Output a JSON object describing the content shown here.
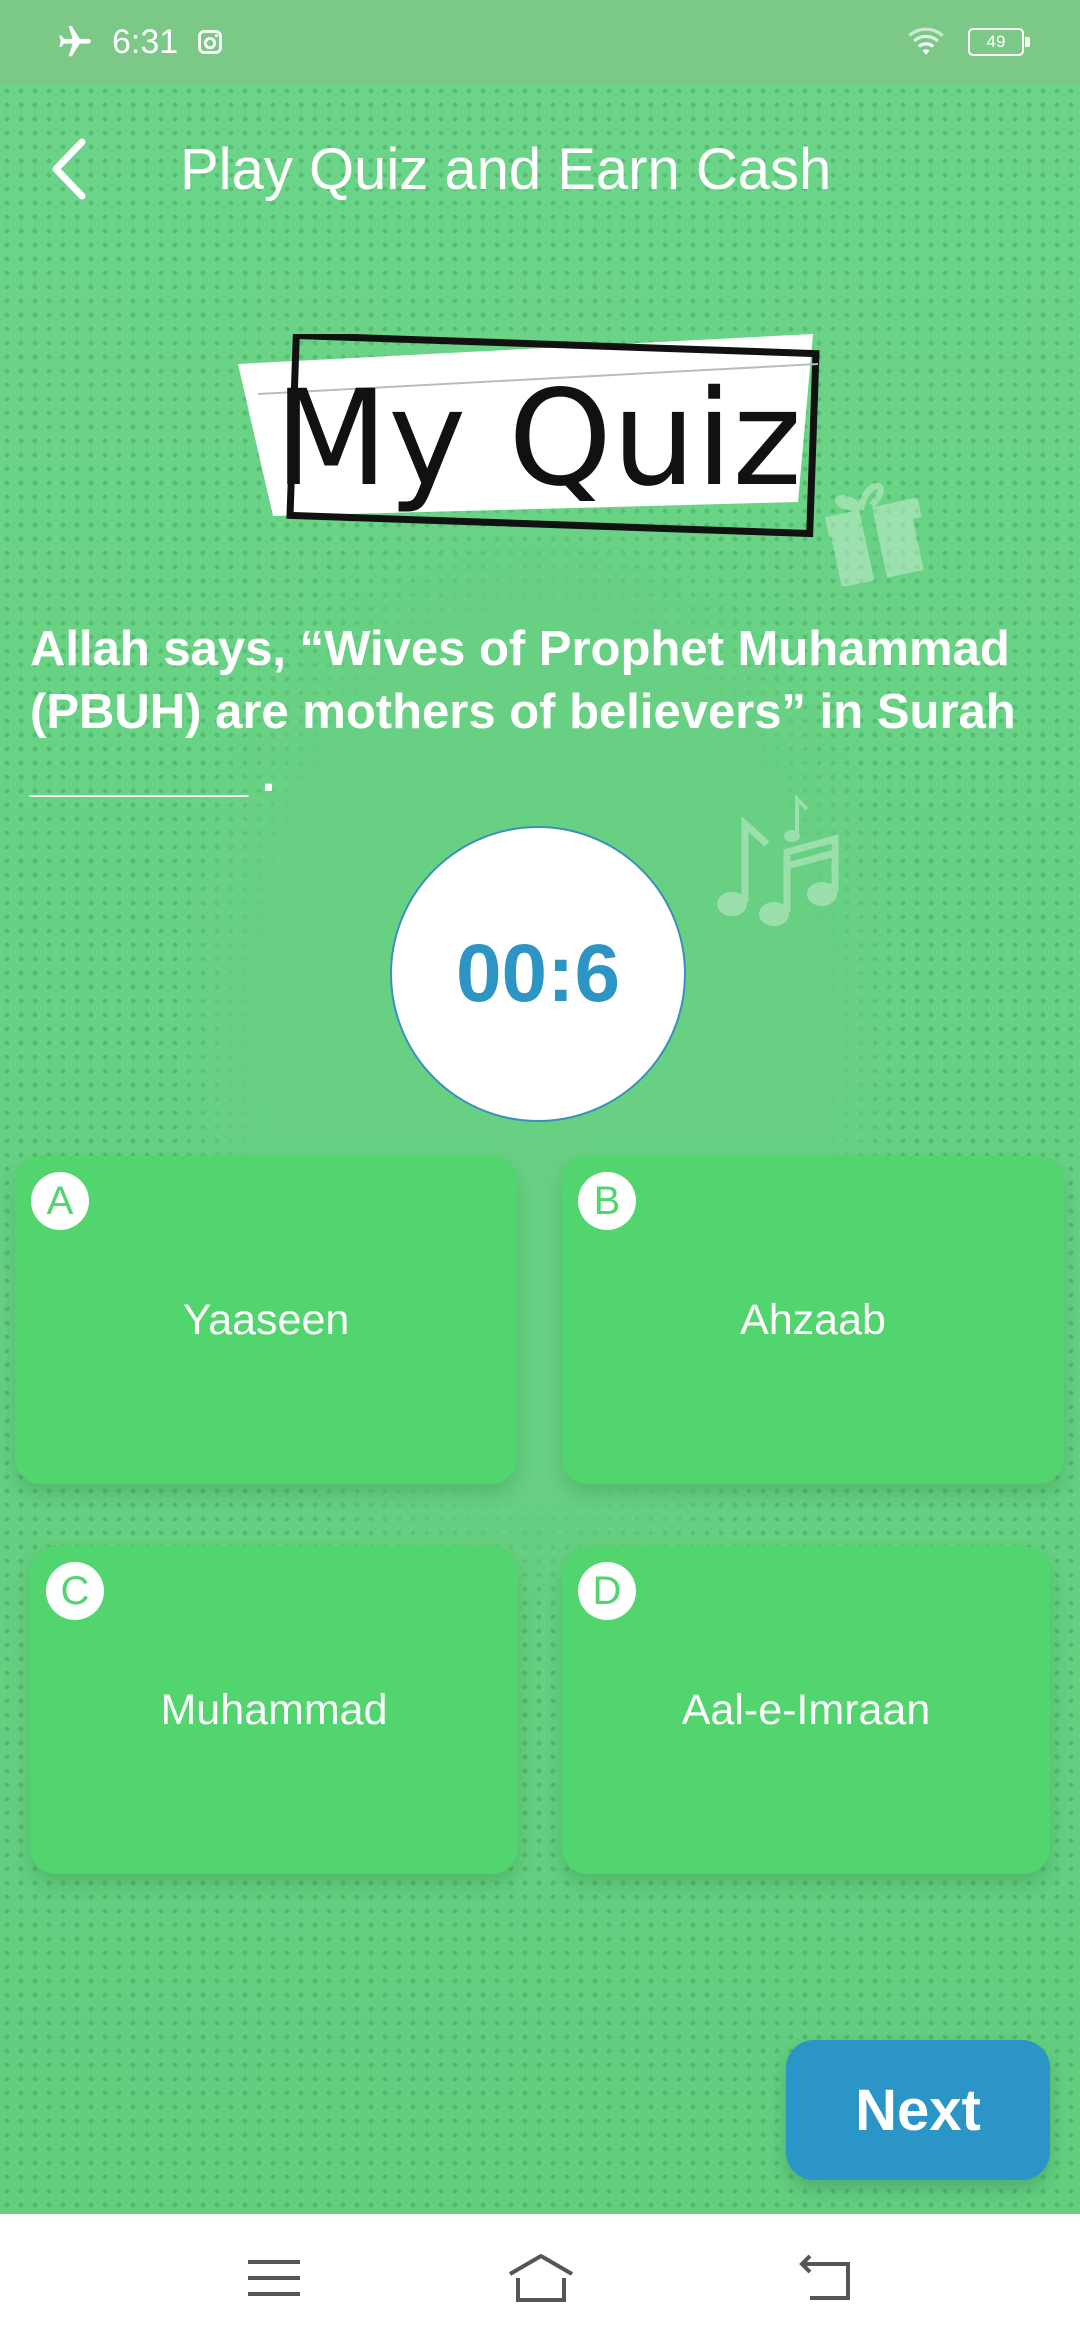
{
  "status_bar": {
    "time": "6:31",
    "battery": "49",
    "icons": [
      "airplane-mode-icon",
      "instagram-icon",
      "wifi-icon",
      "battery-icon"
    ]
  },
  "header": {
    "title": "Play Quiz and Earn Cash",
    "back_icon": "back-arrow-icon"
  },
  "logo": {
    "text": "My Quiz"
  },
  "question": {
    "text": "Allah says, “Wives of Prophet Muhammad (PBUH) are mothers of believers” in Surah ________ ."
  },
  "timer": {
    "value": "00:6"
  },
  "options": [
    {
      "letter": "A",
      "label": "Yaaseen"
    },
    {
      "letter": "B",
      "label": "Ahzaab"
    },
    {
      "letter": "C",
      "label": "Muhammad"
    },
    {
      "letter": "D",
      "label": "Aal-e-Imraan"
    }
  ],
  "next_button": {
    "label": "Next"
  },
  "nav_bar": {
    "icons": [
      "menu-icon",
      "home-icon",
      "back-icon"
    ]
  },
  "colors": {
    "background": "#66cf82",
    "option": "#52d46f",
    "accent": "#2a95c6",
    "status_bar": "#7cc887"
  }
}
